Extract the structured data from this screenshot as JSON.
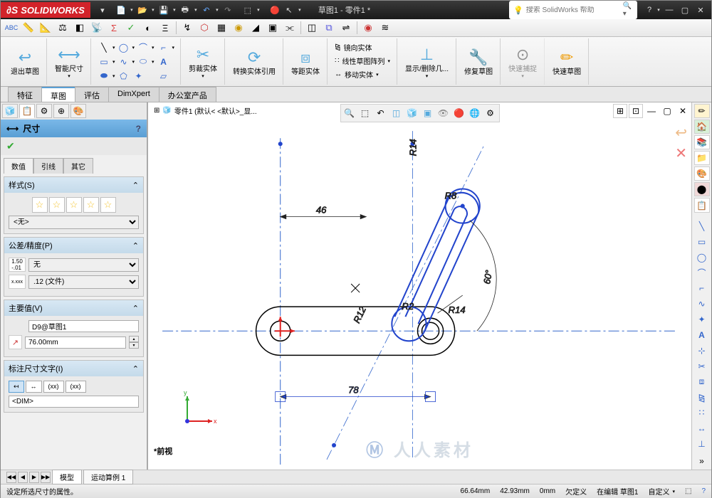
{
  "title_bar": {
    "logo_text": "SOLIDWORKS",
    "doc_title": "草图1 - 零件1 *",
    "search_placeholder": "搜索 SolidWorks 帮助"
  },
  "ribbon": {
    "exit_sketch": "退出草图",
    "smart_dim": "智能尺寸",
    "trim": "剪裁实体",
    "convert": "转换实体引用",
    "offset": "等距实体",
    "mirror": "镜向实体",
    "linear_pattern": "线性草图阵列",
    "move": "移动实体",
    "display_delete": "显示/删除几...",
    "repair": "修复草图",
    "quick_snap": "快速捕捉",
    "quick_sketch": "快速草图"
  },
  "feature_tabs": [
    "特征",
    "草图",
    "评估",
    "DimXpert",
    "办公室产品"
  ],
  "breadcrumb": "零件1  (默认< <默认>_显...",
  "dim_panel": {
    "title": "尺寸",
    "tabs": [
      "数值",
      "引线",
      "其它"
    ],
    "style_header": "样式(S)",
    "style_value": "<无>",
    "tolerance_header": "公差/精度(P)",
    "tolerance_value": "无",
    "precision_value": ".12 (文件)",
    "primary_header": "主要值(V)",
    "dim_name": "D9@草图1",
    "dim_value": "76.00mm",
    "text_header": "标注尺寸文字(I)",
    "dim_tag": "<DIM>"
  },
  "drawing": {
    "dim_46": "46",
    "dim_78": "78",
    "dim_r14_top": "R14",
    "dim_r8": "R8",
    "dim_r14_btm": "R14",
    "dim_r12": "R12",
    "dim_r2": "R2",
    "dim_60": "60°",
    "axis_x": "x",
    "axis_y": "y"
  },
  "front_view": "*前视",
  "watermark": "人人素材",
  "bottom_tabs": [
    "模型",
    "运动算例 1"
  ],
  "status": {
    "hint": "设定所选尺寸的属性。",
    "coord_x": "66.64mm",
    "coord_y": "42.93mm",
    "coord_z": "0mm",
    "under_defined": "欠定义",
    "editing": "在编辑 草图1",
    "custom": "自定义"
  }
}
